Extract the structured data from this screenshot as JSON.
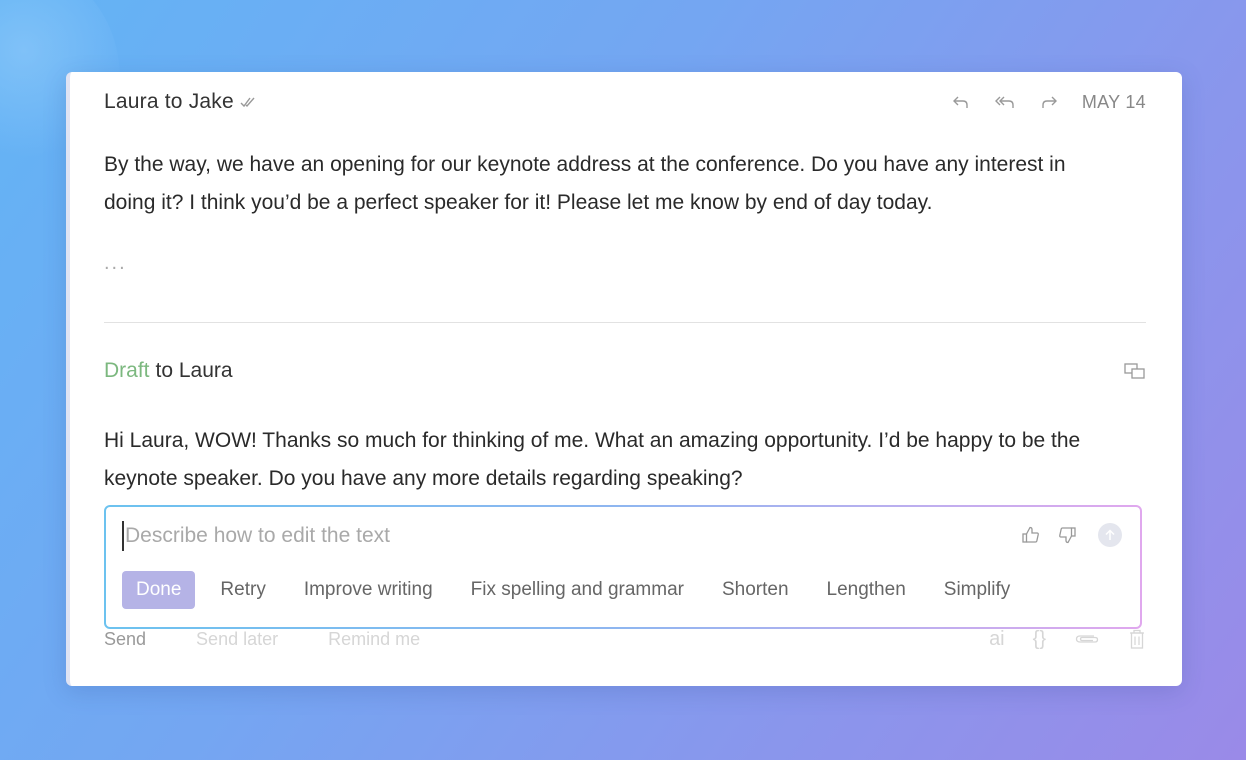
{
  "message": {
    "sender_line": "Laura to Jake",
    "date": "MAY 14",
    "body": "By the way, we have an opening for our keynote address at the conference. Do you have any interest in doing it? I think you’d be a perfect speaker for it! Please let me know by end of day today.",
    "ellipsis": "...",
    "icons": [
      "double-check-icon",
      "reply-icon",
      "reply-all-icon",
      "forward-icon"
    ]
  },
  "draft": {
    "label": "Draft",
    "to": "to Laura",
    "body": "Hi Laura, WOW! Thanks so much for thinking of me. What an amazing opportunity. I’d be happy to be the keynote speaker. Do you have any more details regarding speaking?"
  },
  "ai_editor": {
    "placeholder": "Describe how to edit the text",
    "value": "",
    "actions": {
      "done": "Done",
      "retry": "Retry",
      "improve": "Improve writing",
      "fix": "Fix spelling and grammar",
      "shorten": "Shorten",
      "lengthen": "Lengthen",
      "simplify": "Simplify"
    }
  },
  "footer": {
    "send": "Send",
    "send_later": "Send later",
    "remind_me": "Remind me",
    "ai_label": "ai",
    "snippet_label": "{}"
  },
  "colors": {
    "draft_green": "#7cb87f",
    "done_chip": "#b5b3e6",
    "background_start": "#63b4f5",
    "background_end": "#9a8ae8"
  }
}
